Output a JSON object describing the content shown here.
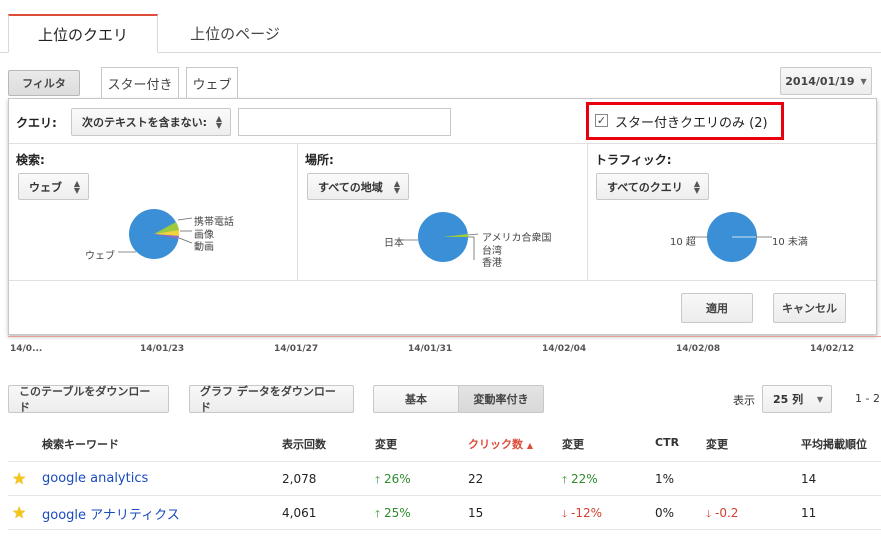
{
  "tabs": [
    "上位のクエリ",
    "上位のページ"
  ],
  "toolbar": {
    "filter_label": "フィルタ",
    "subtabs": [
      "スター付き",
      "ウェブ"
    ],
    "date": "2014/01/19"
  },
  "query_filter": {
    "label": "クエリ:",
    "operator": "次のテキストを含まない:",
    "value": "",
    "starred_only_label": "スター付きクエリのみ (2)",
    "starred_only_checked": true
  },
  "segments": [
    {
      "label": "検索:",
      "selected": "ウェブ",
      "pie_labels": [
        "携帯電話",
        "画像",
        "動画",
        "ウェブ"
      ]
    },
    {
      "label": "場所:",
      "selected": "すべての地域",
      "pie_labels": [
        "日本",
        "アメリカ合衆国",
        "台湾",
        "香港"
      ]
    },
    {
      "label": "トラフィック:",
      "selected": "すべてのクエリ",
      "pie_labels": [
        "10 超",
        "10 未満"
      ]
    }
  ],
  "actions": {
    "apply": "適用",
    "cancel": "キャンセル"
  },
  "axis_dates": [
    "14/0...",
    "14/01/23",
    "14/01/27",
    "14/01/31",
    "14/02/04",
    "14/02/08",
    "14/02/12"
  ],
  "table_controls": {
    "download_table": "このテーブルをダウンロード",
    "download_graph": "グラフ データをダウンロード",
    "view_basic": "基本",
    "view_change": "変動率付き",
    "rows_label": "表示",
    "rows_value": "25 列",
    "pager": "1 - 2"
  },
  "table": {
    "headers": [
      "検索キーワード",
      "表示回数",
      "変更",
      "クリック数",
      "変更",
      "CTR",
      "変更",
      "平均掲載順位"
    ],
    "rows": [
      {
        "keyword": "google analytics",
        "impressions": "2,078",
        "imp_change": "26%",
        "clicks": "22",
        "click_change": "22%",
        "ctr": "1%",
        "ctr_change": "",
        "position": "14"
      },
      {
        "keyword": "google アナリティクス",
        "impressions": "4,061",
        "imp_change": "25%",
        "clicks": "15",
        "click_change": "-12%",
        "ctr": "0%",
        "ctr_change": "-0.2",
        "position": "11"
      }
    ]
  },
  "colors": {
    "accent_red": "#dd4b39",
    "pie_blue": "#3a8fd6",
    "pie_green": "#9ccc3c",
    "pie_yellow": "#f3d33c",
    "up_green": "#2e8b2e",
    "down_red": "#d23f31",
    "highlight": "#e8000d"
  }
}
